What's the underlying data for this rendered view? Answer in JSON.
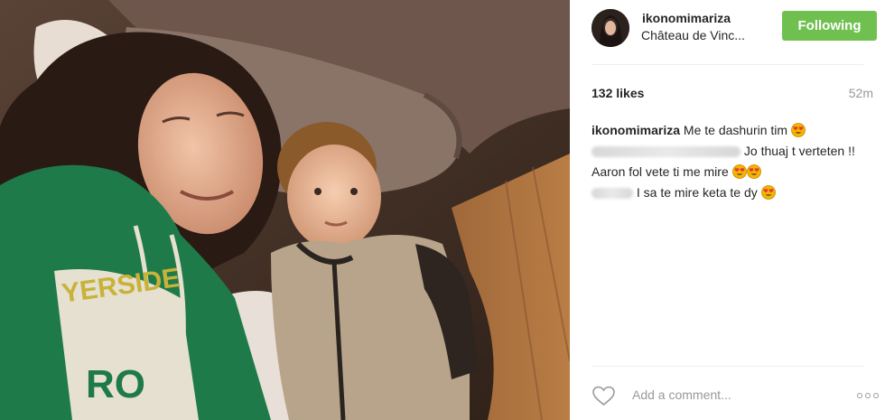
{
  "header": {
    "username": "ikonomimariza",
    "location": "Château de Vinc...",
    "follow_label": "Following"
  },
  "post": {
    "likes": "132 likes",
    "time": "52m",
    "caption": {
      "author": "ikonomimariza",
      "text": "Me te dashurin tim"
    },
    "comments": [
      {
        "author_hidden": true,
        "text_line1": "Jo thuaj t verteten !!",
        "text_line2": "Aaron fol vete ti me mire"
      },
      {
        "author_hidden": true,
        "text": "I sa te mire keta te dy"
      }
    ]
  },
  "footer": {
    "comment_placeholder": "Add a comment...",
    "like_icon": "heart-outline-icon",
    "more_icon": "more-options-icon"
  },
  "colors": {
    "follow_button": "#70c050",
    "muted_text": "#999999"
  }
}
